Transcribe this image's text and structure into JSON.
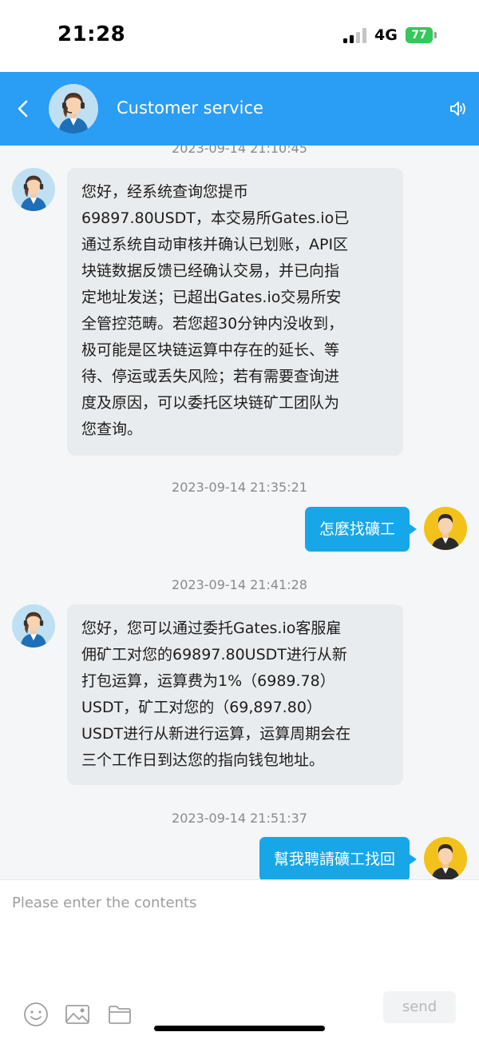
{
  "status_bar": {
    "time": "21:28",
    "network": "4G",
    "battery": "77"
  },
  "header": {
    "title": "Customer service",
    "back_icon": "chevron-left-icon",
    "speaker_icon": "speaker-icon"
  },
  "messages": [
    {
      "timestamp": "2023-09-14 21:10:45",
      "from": "agent",
      "text": "您好，经系统查询您提币\n69897.80USDT，本交易所Gates.io已\n通过系统自动审核并确认已划账，API区\n块链数据反馈已经确认交易，并已向指\n定地址发送；已超出Gates.io交易所安\n全管控范畴。若您超30分钟内没收到，\n极可能是区块链运算中存在的延长、等\n待、停运或丢失风险；若有需要查询进\n度及原因，可以委托区块链矿工团队为\n您查询。"
    },
    {
      "timestamp": "2023-09-14 21:35:21",
      "from": "user",
      "text": "怎麼找礦工"
    },
    {
      "timestamp": "2023-09-14 21:41:28",
      "from": "agent",
      "text": "您好，您可以通过委托Gates.io客服雇\n佣矿工对您的69897.80USDT进行从新\n打包运算，运算费为1%（6989.78）\nUSDT，矿工对您的（69,897.80）\nUSDT进行从新进行运算，运算周期会在\n三个工作日到达您的指向钱包地址。"
    },
    {
      "timestamp": "2023-09-14 21:51:37",
      "from": "user",
      "text": "幫我聘請礦工找回"
    }
  ],
  "composer": {
    "placeholder": "Please enter the contents",
    "send_label": "send",
    "tools": [
      "emoji-icon",
      "image-icon",
      "folder-icon"
    ]
  },
  "colors": {
    "header": "#2a9df4",
    "outgoing_bubble": "#17a7e8",
    "incoming_bubble": "#e9ecee",
    "chat_background": "#f5f6f7",
    "battery": "#34c759"
  }
}
